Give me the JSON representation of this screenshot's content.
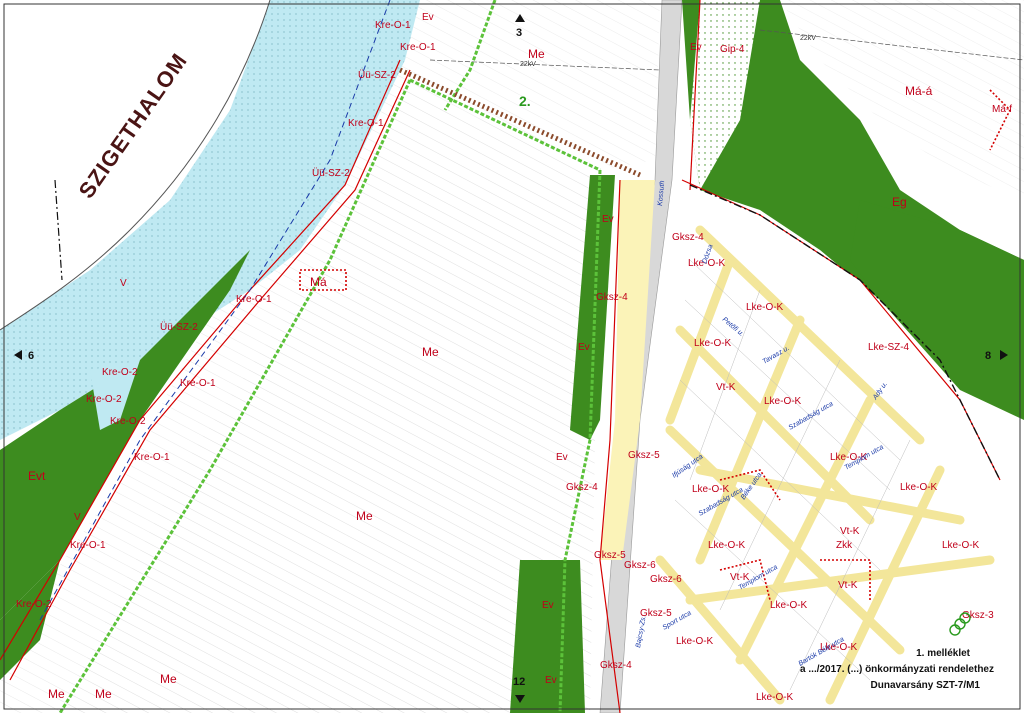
{
  "town_name": "SZIGETHALOM",
  "plan_number": "2.",
  "sheet_refs": [
    {
      "label": "3",
      "dir": "up"
    },
    {
      "label": "6",
      "dir": "left"
    },
    {
      "label": "8",
      "dir": "right"
    },
    {
      "label": "12",
      "dir": "down"
    }
  ],
  "annex_title": "1. melléklet",
  "annex_line2": "a .../2017. (...) önkormányzati rendelethez",
  "annex_line3": "Dunavarsány SZT-7/M1",
  "power_line_label": "22kV",
  "colors": {
    "water": "#bfe9f2",
    "forest": "#3d8c1f",
    "residential": "#fbf3b8",
    "road": "#d8d8d8",
    "zone_border": "#d40000",
    "green_boundary": "#5cc23a"
  },
  "zones": {
    "kre_o_1": "Kre-O-1",
    "kre_o_2": "Kre-O-2",
    "uu_sz_2": "Üü-SZ-2",
    "me": "Me",
    "ev": "Ev",
    "evt": "Evt",
    "gip_4": "Gip-4",
    "ma_a": "Má-á",
    "ma_f": "Má-f",
    "eg": "Eg",
    "ma": "Má",
    "v": "V",
    "gksz_4": "Gksz-4",
    "gksz_5": "Gksz-5",
    "gksz_6": "Gksz-6",
    "gksz_3": "Gksz-3",
    "lke_o_k": "Lke-O-K",
    "lke_sz_4": "Lke-SZ-4",
    "vt_k": "Vt-K",
    "zkk": "Zkk"
  },
  "streets": {
    "dozsa": "Dózsa",
    "petofi": "Petőfi u.",
    "szabadsag": "Szabadság utca",
    "templom": "Templom utca",
    "sport": "Sport utca",
    "bartok": "Bartók Béla utca",
    "ifjusag": "Ifjúság utca",
    "beke": "Béke utca",
    "ady": "Ady u.",
    "tavasz": "Tavasz u.",
    "kossuth": "Kossuth",
    "bajcsy": "Bajcsy-Zs."
  }
}
